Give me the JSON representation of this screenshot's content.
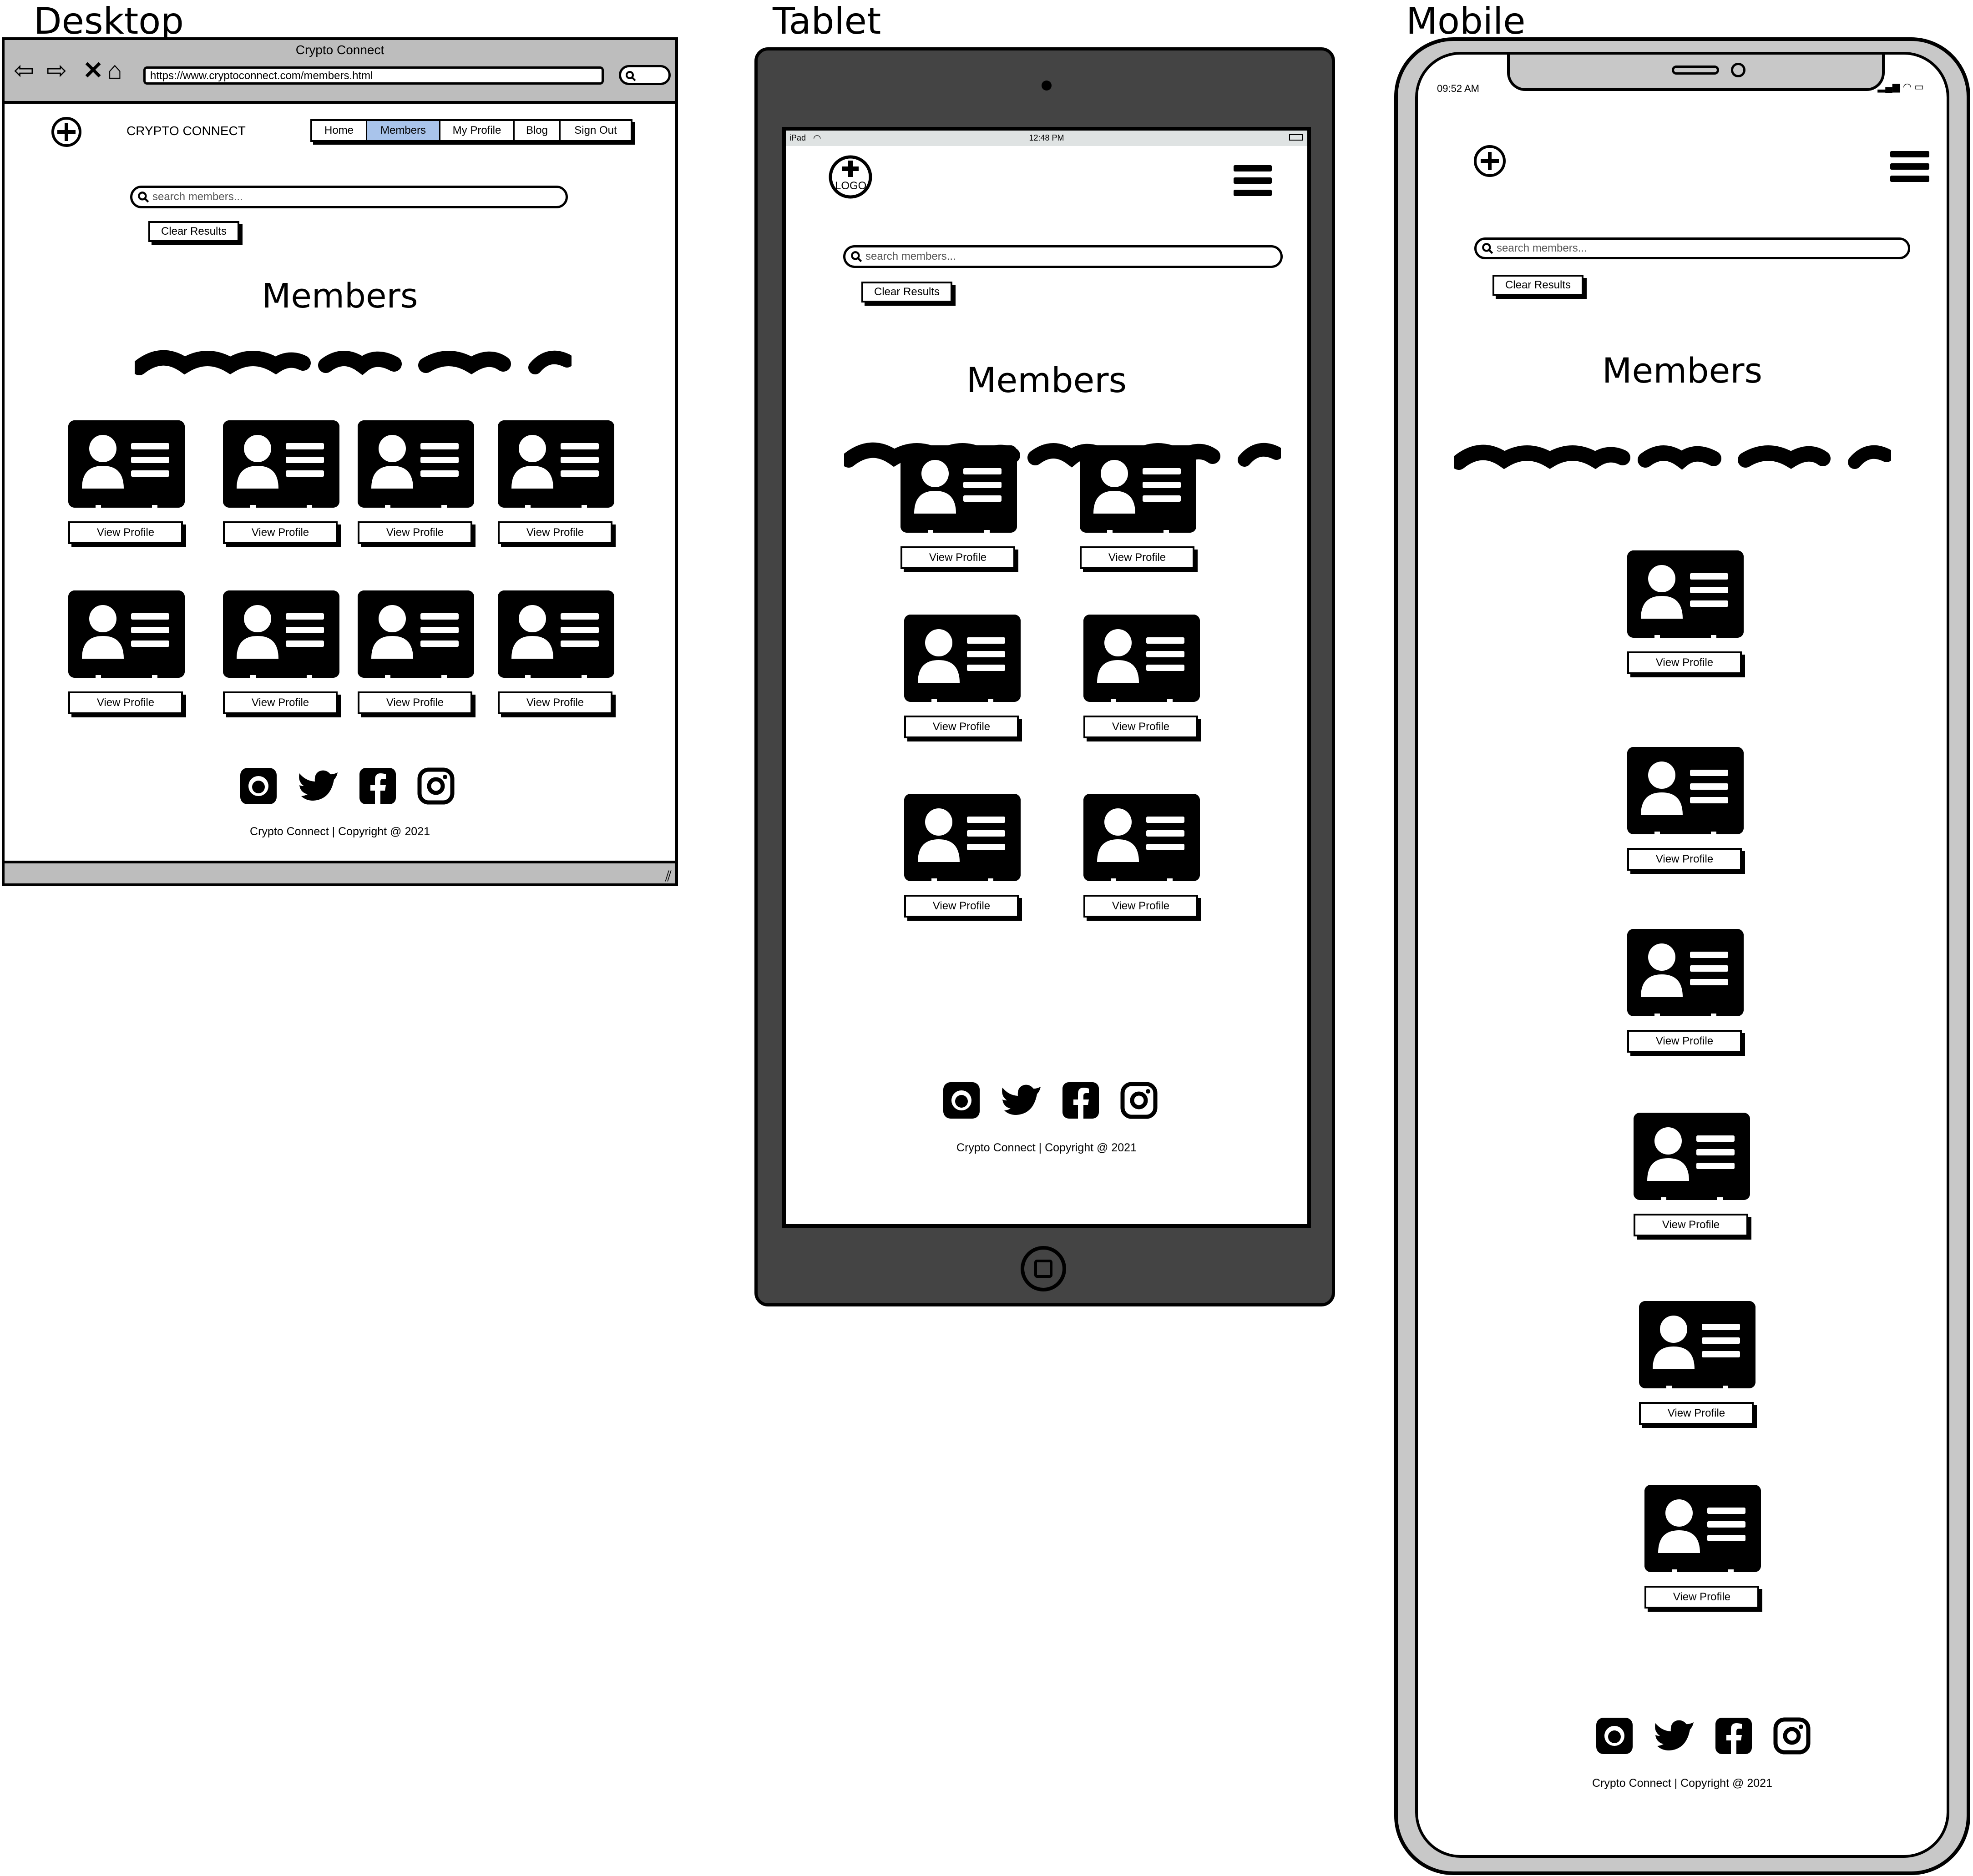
{
  "labels": {
    "desktop": "Desktop",
    "tablet": "Tablet",
    "mobile": "Mobile"
  },
  "desktop": {
    "window_title": "Crypto Connect",
    "url": "https://www.cryptoconnect.com/members.html",
    "brand": "CRYPTO CONNECT",
    "nav": [
      "Home",
      "Members",
      "My Profile",
      "Blog",
      "Sign Out"
    ],
    "active_nav": "Members",
    "active_color": "#a9c4eb"
  },
  "tablet": {
    "status_left": "iPad",
    "status_time": "12:48 PM",
    "logo_text": "LOGO"
  },
  "mobile": {
    "status_time": "09:52 AM"
  },
  "search": {
    "placeholder": "search members..."
  },
  "clear_button": "Clear Results",
  "heading": "Members",
  "view_profile": "View Profile",
  "footer": {
    "social_icons": [
      "github-icon",
      "twitter-icon",
      "facebook-icon",
      "instagram-icon"
    ],
    "copyright": "Crypto Connect | Copyright @ 2021"
  }
}
